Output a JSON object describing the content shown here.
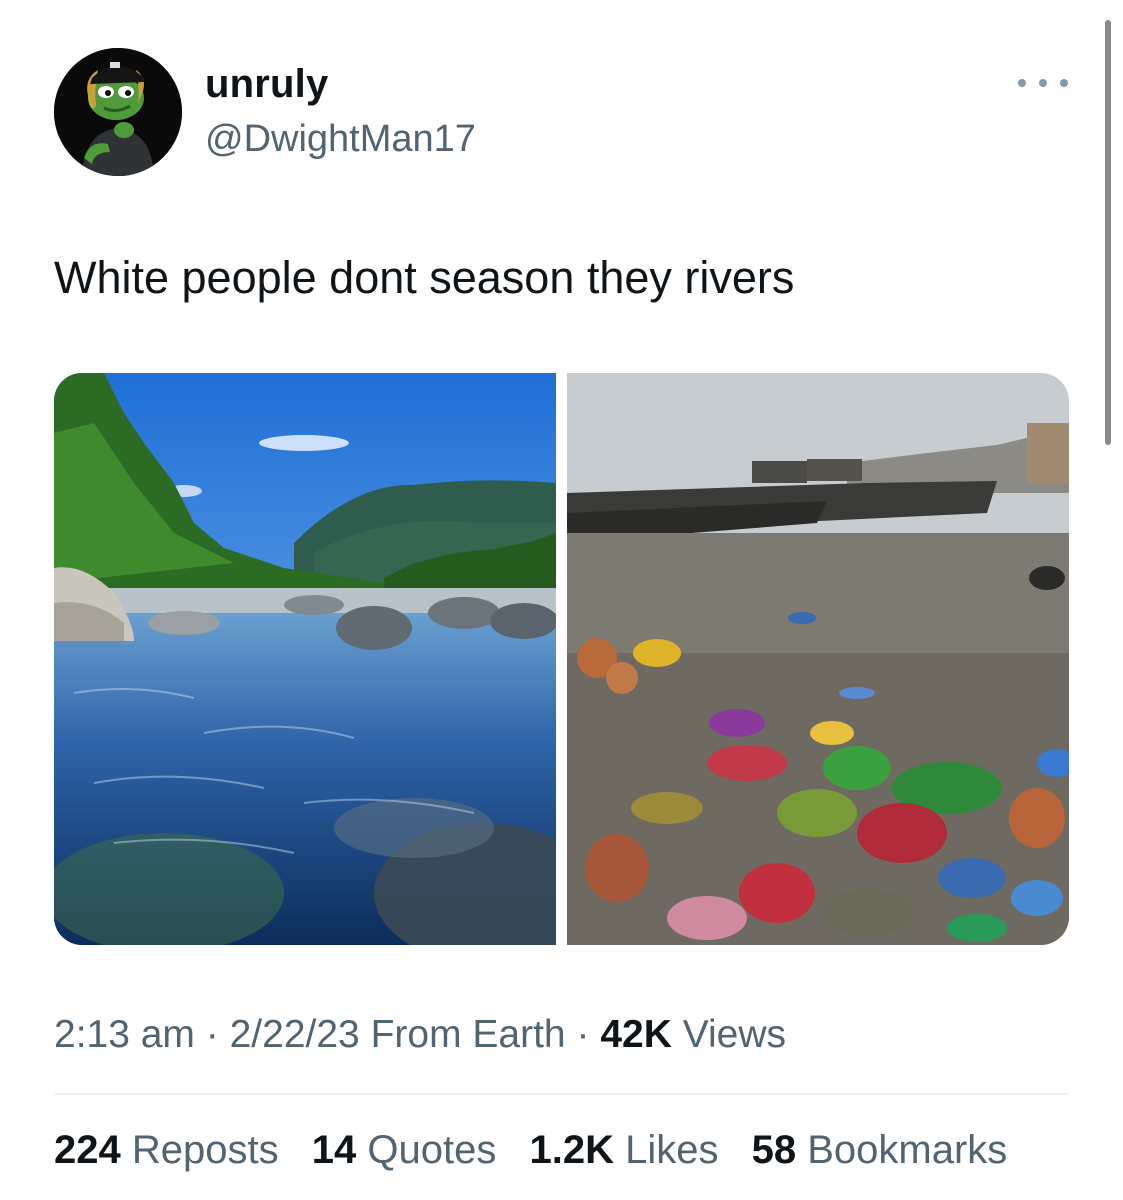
{
  "tweet": {
    "author": {
      "display_name": "unruly",
      "handle": "@DwightMan17",
      "avatar_icon": "frog-avatar-icon"
    },
    "more_icon": "more-dots-icon",
    "text": "White people dont season they rivers",
    "media": [
      {
        "name": "photo-clear-mountain-river"
      },
      {
        "name": "photo-polluted-river"
      }
    ],
    "meta": {
      "time": "2:13 am",
      "separator": "·",
      "date": "2/22/23",
      "source": "From Earth",
      "views_count": "42K",
      "views_label": "Views"
    },
    "stats": {
      "reposts_count": "224",
      "reposts_label": "Reposts",
      "quotes_count": "14",
      "quotes_label": "Quotes",
      "likes_count": "1.2K",
      "likes_label": "Likes",
      "bookmarks_count": "58",
      "bookmarks_label": "Bookmarks"
    }
  },
  "colors": {
    "primary_text": "#0f1419",
    "secondary_text": "#536471",
    "divider": "#eff3f4"
  }
}
